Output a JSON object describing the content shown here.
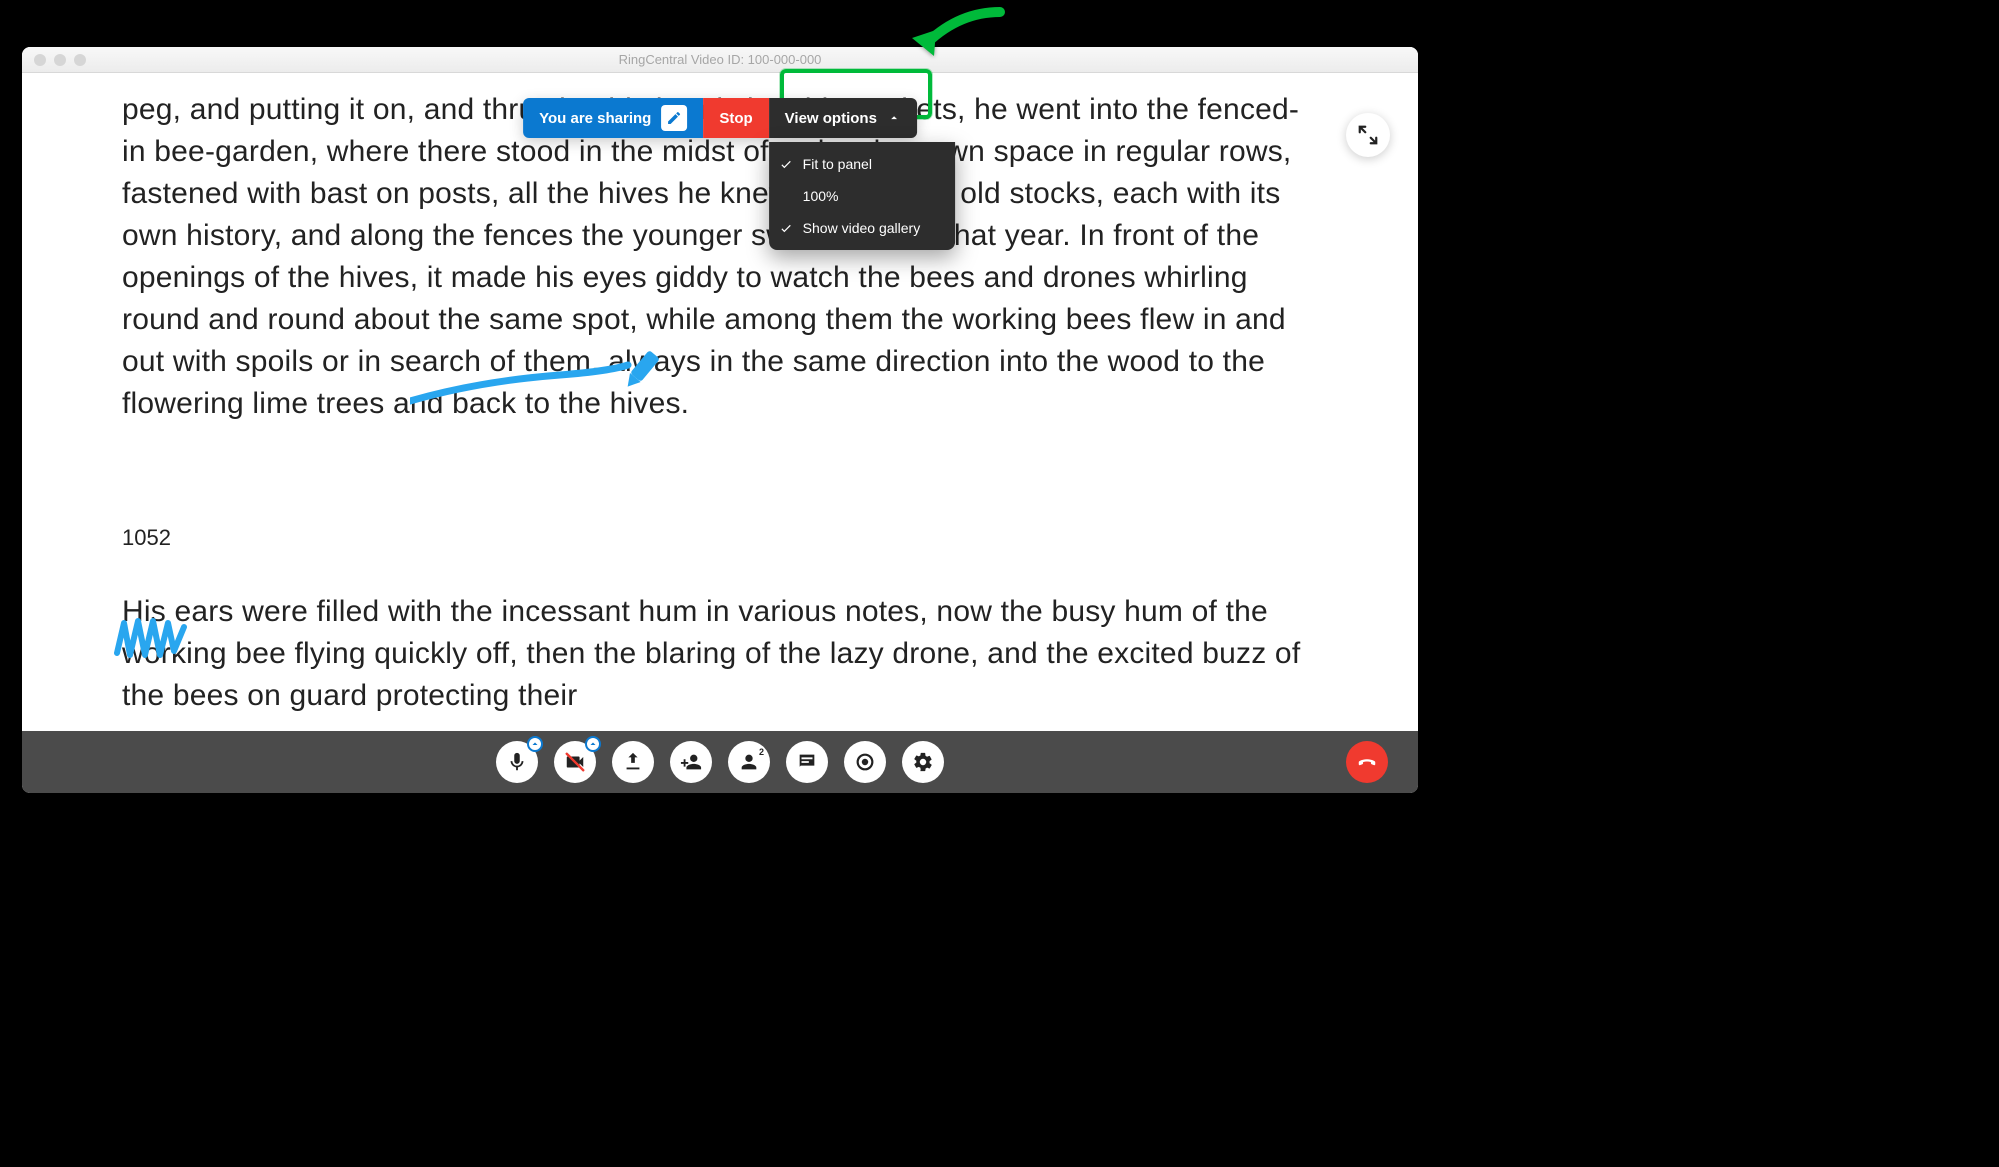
{
  "window": {
    "title": "RingCentral Video ID: 100-000-000"
  },
  "sharebar": {
    "sharing_label": "You are sharing",
    "stop_label": "Stop",
    "view_options_label": "View options"
  },
  "view_options_menu": {
    "items": [
      {
        "label": "Fit to panel",
        "checked": true
      },
      {
        "label": "100%",
        "checked": false
      },
      {
        "label": "Show video gallery",
        "checked": true
      }
    ]
  },
  "document": {
    "paragraph1": "peg, and putting it on, and thrusting his hands into his pockets, he went into the fenced-in bee-garden, where there stood in the midst of a closely mown space in regular rows, fastened with bast on posts, all the hives he knew so well, the old stocks, each with its own history, and along the fences the younger swarms hived that year. In front of the openings of the hives, it made his eyes giddy to watch the bees and drones whirling round and round about the same spot, while among them the working bees flew in and out with spoils or in search of them, always in the same direction into the wood to the flowering lime trees and back to the hives.",
    "page_number": "1052",
    "paragraph2": "His ears were filled with the incessant hum in various notes, now the busy hum of the working bee flying quickly off, then the blaring of the lazy drone, and the excited buzz of the bees on guard protecting their"
  },
  "participants": {
    "count": "2"
  },
  "colors": {
    "blue": "#0b79d0",
    "red": "#f03a2f",
    "green": "#00ba3a",
    "annotation": "#29a6ef",
    "toolbar": "#4b4b4b"
  }
}
